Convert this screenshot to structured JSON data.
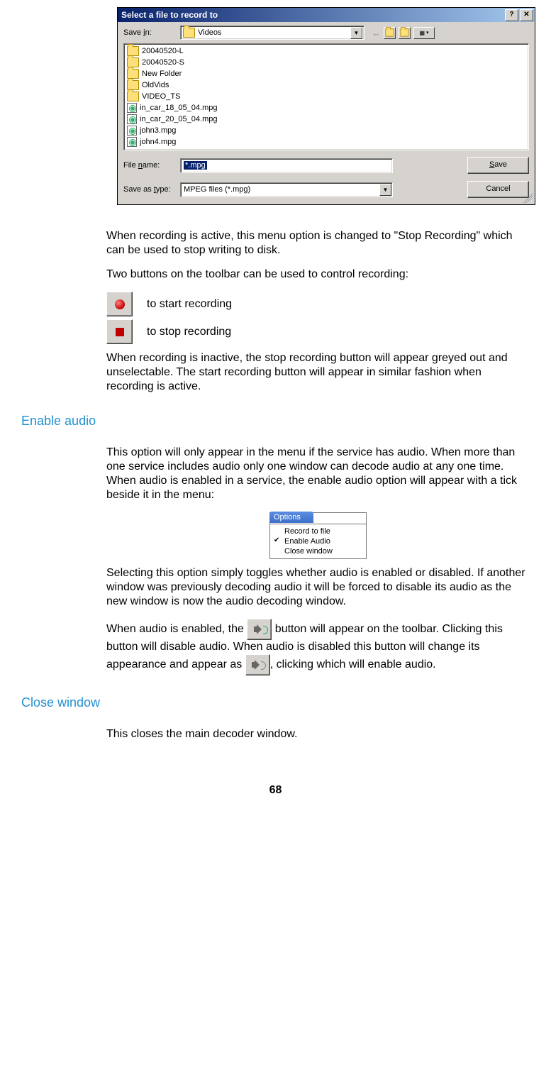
{
  "dialog": {
    "title": "Select a file to record to",
    "help_char": "?",
    "close_char": "✕",
    "save_in_label": "Save in:",
    "save_in_value": "Videos",
    "nav": {
      "back": "←",
      "up": "⇧",
      "new": "✳",
      "view": "▦",
      "view_arrow": "▾"
    },
    "files_col1": [
      {
        "name": "20040520-L",
        "type": "folder"
      },
      {
        "name": "20040520-S",
        "type": "folder"
      },
      {
        "name": "New Folder",
        "type": "folder"
      },
      {
        "name": "OldVids",
        "type": "folder"
      },
      {
        "name": "VIDEO_TS",
        "type": "folder"
      },
      {
        "name": "in_car_18_05_04.mpg",
        "type": "mpg"
      },
      {
        "name": "in_car_20_05_04.mpg",
        "type": "mpg"
      },
      {
        "name": "john3.mpg",
        "type": "mpg"
      }
    ],
    "files_col2": [
      {
        "name": "john4.mpg",
        "type": "mpg"
      }
    ],
    "filename_label": "File name:",
    "filename_value": "*.mpg",
    "filetype_label": "Save as type:",
    "filetype_value": "MPEG files (*.mpg)",
    "save_btn": "Save",
    "cancel_btn": "Cancel"
  },
  "body": {
    "p1": "When recording is active, this menu option is changed to \"Stop Recording\" which can be used to stop writing to disk.",
    "p2": "Two buttons on the toolbar can be used to control recording:",
    "start_rec": "to start recording",
    "stop_rec": "to stop recording",
    "p3": "When recording is inactive, the stop recording button will appear greyed out and unselectable. The start recording button will appear in similar fashion when recording is active.",
    "h_enable_audio": "Enable audio",
    "p4": "This option will only appear in the menu if the service has audio. When more than one service includes audio only one window can decode audio at any one time. When audio is enabled in a service, the enable audio option will appear with a tick beside it in the menu:",
    "options_menu": {
      "tab": "Options",
      "items": [
        "Record to file",
        "Enable Audio",
        "Close window"
      ],
      "checked_index": 1
    },
    "p5": "Selecting this option simply toggles whether audio is enabled or disabled. If another window was previously decoding audio it will be forced to disable its audio as the new window is now the audio decoding window.",
    "p6a": "When audio is enabled, the ",
    "p6b": " button will appear on the toolbar. Clicking this button will disable audio. When audio is disabled this button will change its appearance and appear as ",
    "p6c": ", clicking which will enable audio.",
    "h_close_window": "Close window",
    "p7": "This closes the main decoder window."
  },
  "page_number": "68"
}
